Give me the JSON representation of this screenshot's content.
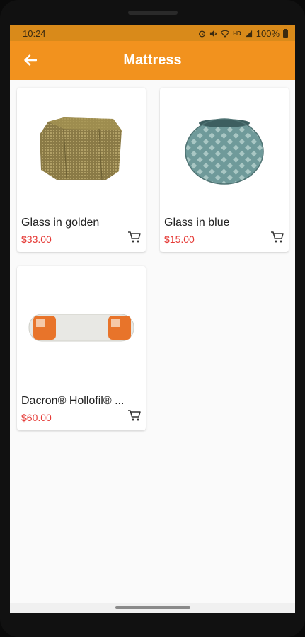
{
  "status_bar": {
    "time": "10:24",
    "icons": [
      "alarm-icon",
      "mute-icon",
      "wifi-icon",
      "hd-icon",
      "signal-icon"
    ],
    "hd_label": "HD",
    "battery_text": "100%"
  },
  "app_bar": {
    "title": "Mattress",
    "back_icon": "arrow-left-icon",
    "color": "#f2921e"
  },
  "products": [
    {
      "name": "Glass in golden",
      "price": "$33.00",
      "image": "golden-glass-vase"
    },
    {
      "name": "Glass in blue",
      "price": "$15.00",
      "image": "blue-glass-bowl"
    },
    {
      "name": "Dacron® Hollofil® ...",
      "price": "$60.00",
      "image": "bolster-pillow"
    }
  ],
  "colors": {
    "price": "#e53935",
    "accent": "#f2921e"
  }
}
